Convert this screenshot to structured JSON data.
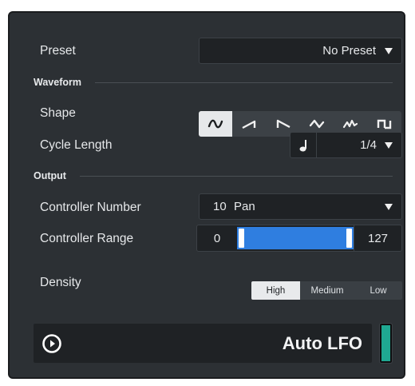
{
  "preset": {
    "label": "Preset",
    "value": "No Preset"
  },
  "sections": {
    "waveform": "Waveform",
    "output": "Output"
  },
  "shape": {
    "label": "Shape",
    "options": [
      "sine-wave",
      "sawtooth-wave",
      "ramp-down-wave",
      "triangle-wave",
      "random-wave",
      "square-wave"
    ],
    "selected": "sine-wave"
  },
  "cycle_length": {
    "label": "Cycle Length",
    "note_icon": "quarter-note-icon",
    "value": "1/4"
  },
  "controller_number": {
    "label": "Controller Number",
    "number": "10",
    "name": "Pan"
  },
  "controller_range": {
    "label": "Controller Range",
    "min": "0",
    "max": "127",
    "accent": "#2f7ee0"
  },
  "density": {
    "label": "Density",
    "options": [
      "High",
      "Medium",
      "Low"
    ],
    "selected": "High"
  },
  "auto_lfo": {
    "title": "Auto LFO",
    "play_icon": "play-circle-icon",
    "indicator_color": "#1fa892"
  }
}
